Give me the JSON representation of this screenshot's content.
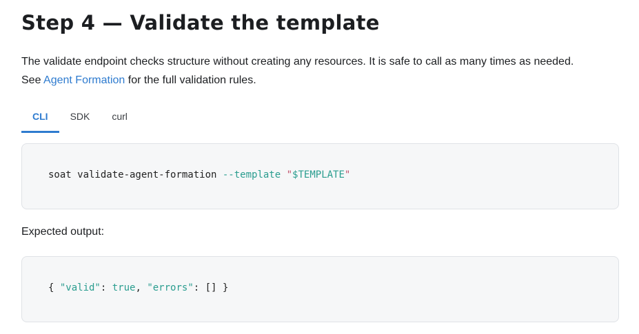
{
  "heading": "Step 4 — Validate the template",
  "intro": {
    "line1": "The validate endpoint checks structure without creating any resources. It is safe to call as many times as needed.",
    "see": "See ",
    "link_text": "Agent Formation",
    "line2_rest": " for the full validation rules."
  },
  "tabs": [
    {
      "label": "CLI",
      "active": true
    },
    {
      "label": "SDK",
      "active": false
    },
    {
      "label": "curl",
      "active": false
    }
  ],
  "command": {
    "cmd": "soat validate-agent-formation ",
    "flag": "--template",
    "space": " ",
    "quote_open": "\"",
    "value": "$TEMPLATE",
    "quote_close": "\""
  },
  "expected_label": "Expected output:",
  "output": {
    "brace_open": "{ ",
    "key1": "\"valid\"",
    "colon1": ": ",
    "val1": "true",
    "comma": ", ",
    "key2": "\"errors\"",
    "colon2": ": ",
    "val2": "[]",
    "brace_close": " }"
  },
  "colors": {
    "accent": "#2e7bcf",
    "code_bg": "#f6f7f8",
    "token_teal": "#2a9d8f",
    "token_quote": "#c0506b"
  }
}
